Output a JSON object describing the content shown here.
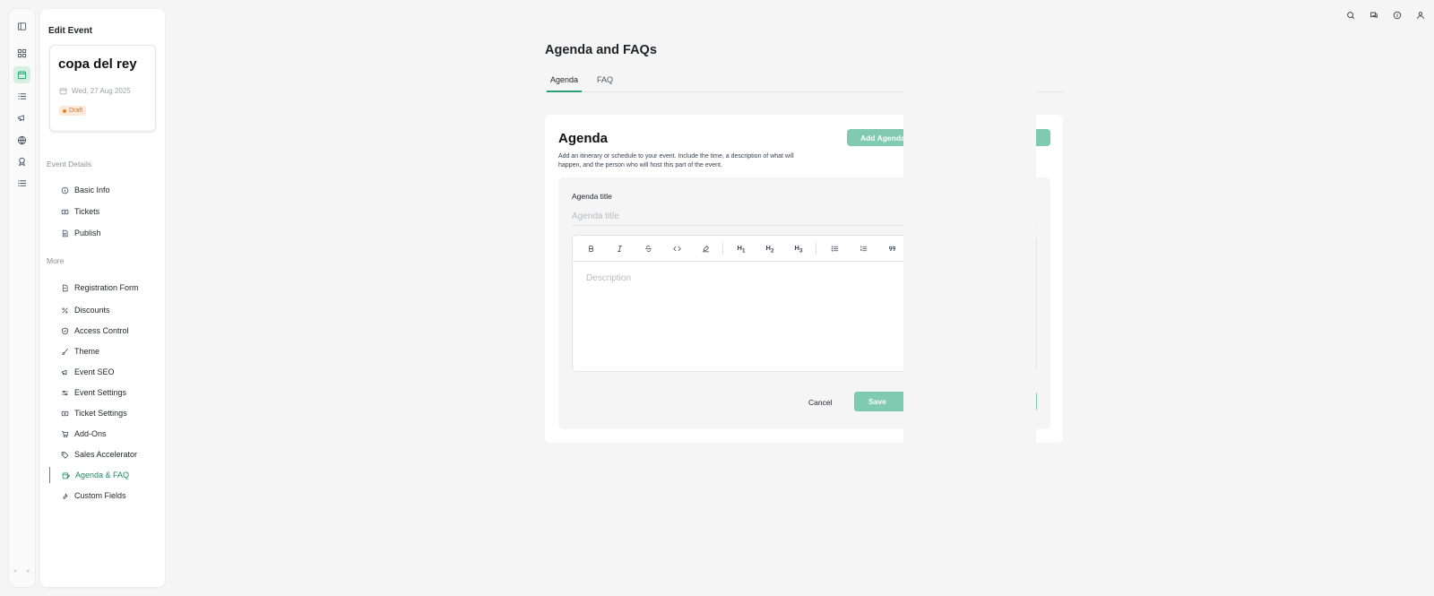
{
  "rail": {
    "icons": [
      "sidebar-toggle-icon",
      "dashboard-icon",
      "calendar-icon",
      "list-icon",
      "megaphone-icon",
      "globe-icon",
      "award-icon",
      "menu-list-icon"
    ],
    "active_color": "#2a9d76"
  },
  "panel": {
    "title": "Edit Event",
    "event": {
      "name": "copa del rey",
      "date": "Wed, 27 Aug 2025",
      "status": "Draft"
    },
    "sections": {
      "details_label": "Event Details",
      "more_label": "More"
    },
    "details_items": [
      {
        "label": "Basic Info",
        "icon": "info-icon"
      },
      {
        "label": "Tickets",
        "icon": "ticket-icon"
      },
      {
        "label": "Publish",
        "icon": "document-icon"
      }
    ],
    "more_items": [
      {
        "label": "Registration Form",
        "icon": "form-icon"
      },
      {
        "label": "Discounts",
        "icon": "percent-icon"
      },
      {
        "label": "Access Control",
        "icon": "shield-icon"
      },
      {
        "label": "Theme",
        "icon": "brush-icon"
      },
      {
        "label": "Event SEO",
        "icon": "megaphone-icon"
      },
      {
        "label": "Event Settings",
        "icon": "sliders-icon"
      },
      {
        "label": "Ticket Settings",
        "icon": "ticket-icon"
      },
      {
        "label": "Add-Ons",
        "icon": "cart-icon"
      },
      {
        "label": "Sales Accelerator",
        "icon": "tag-icon"
      },
      {
        "label": "Agenda & FAQ",
        "icon": "calendar-edit-icon",
        "active": true
      },
      {
        "label": "Custom Fields",
        "icon": "wrench-icon"
      }
    ]
  },
  "header": {
    "icons": [
      "search-icon",
      "chat-icon",
      "info-icon",
      "user-icon"
    ]
  },
  "main": {
    "title": "Agenda and FAQs",
    "tabs": [
      {
        "label": "Agenda",
        "active": true
      },
      {
        "label": "FAQ",
        "active": false
      }
    ],
    "card": {
      "title": "Agenda",
      "description": "Add an itinerary or schedule to your event. Include the time, a description of what will happen, and the person who will host this part of the event.",
      "add_button": "Add Agenda",
      "form": {
        "title_label": "Agenda title",
        "title_placeholder": "Agenda title",
        "description_placeholder": "Description",
        "cancel": "Cancel",
        "save": "Save"
      },
      "toolbar": [
        "bold-icon",
        "italic-icon",
        "strikethrough-icon",
        "code-icon",
        "highlight-icon",
        "H1",
        "H2",
        "H3",
        "bullet-list-icon",
        "ordered-list-icon",
        "quote-icon",
        "link-icon",
        "image-icon",
        "undo-icon",
        "chevron-right-icon"
      ]
    },
    "accent": "#7fcab0"
  }
}
